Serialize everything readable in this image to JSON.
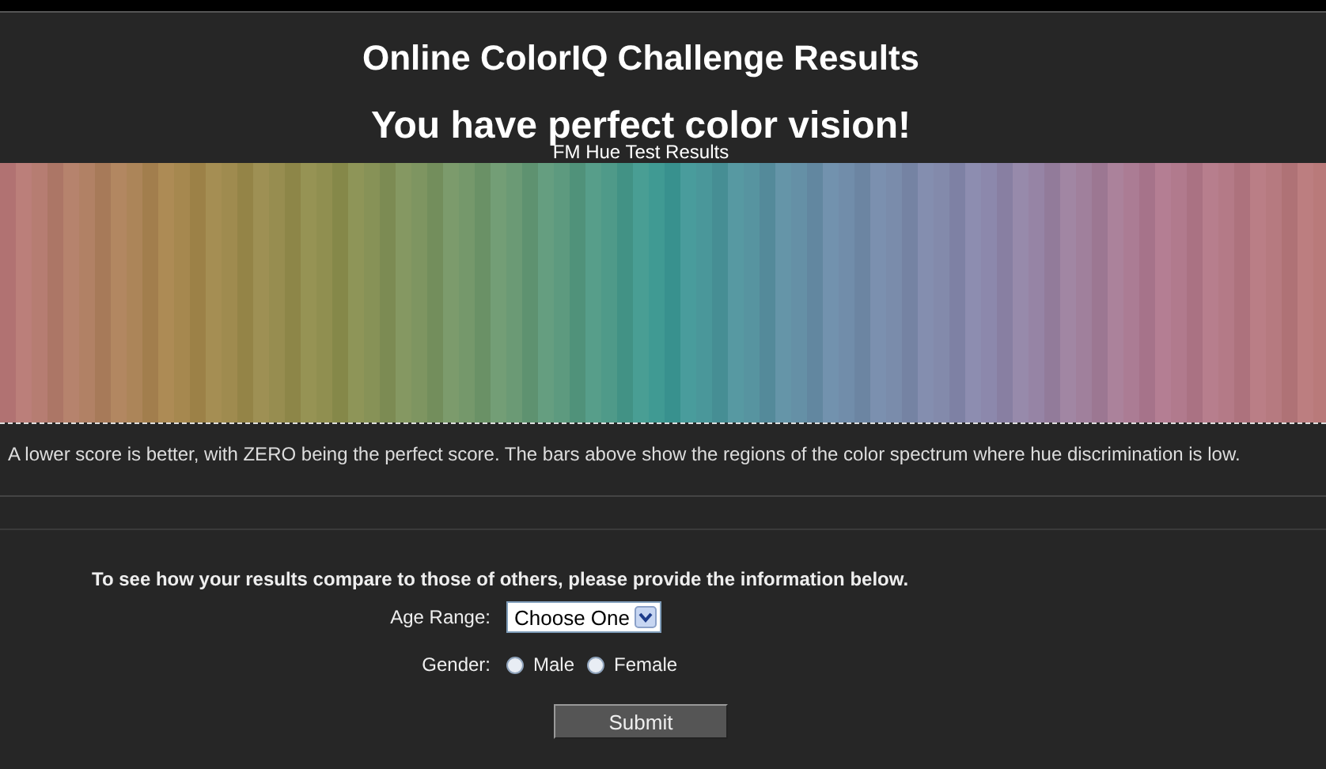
{
  "title": "Online ColorIQ Challenge Results",
  "subtitle": "You have perfect color vision!",
  "chart_caption": "FM Hue Test Results",
  "note": "A lower score is better, with ZERO being the perfect score. The bars above show the regions of the color spectrum where hue discrimination is low.",
  "form": {
    "intro": "To see how your results compare to those of others, please provide the information below.",
    "age_range": {
      "label": "Age Range:",
      "value": "Choose One"
    },
    "gender": {
      "label": "Gender:",
      "options": [
        {
          "label": "Male",
          "selected": false
        },
        {
          "label": "Female",
          "selected": false
        }
      ]
    },
    "submit": "Submit"
  }
}
